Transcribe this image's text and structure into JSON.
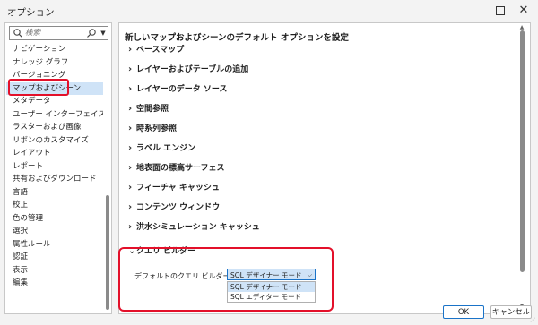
{
  "window": {
    "title": "オプション"
  },
  "search": {
    "placeholder": "検索"
  },
  "sidebar": {
    "items": [
      {
        "label": "ナビゲーション",
        "selected": false
      },
      {
        "label": "ナレッジ グラフ",
        "selected": false
      },
      {
        "label": "バージョニング",
        "selected": false
      },
      {
        "label": "マップおよびシーン",
        "selected": true
      },
      {
        "label": "メタデータ",
        "selected": false
      },
      {
        "label": "ユーザー インターフェイス",
        "selected": false
      },
      {
        "label": "ラスターおよび画像",
        "selected": false
      },
      {
        "label": "リボンのカスタマイズ",
        "selected": false
      },
      {
        "label": "レイアウト",
        "selected": false
      },
      {
        "label": "レポート",
        "selected": false
      },
      {
        "label": "共有およびダウンロード",
        "selected": false
      },
      {
        "label": "言語",
        "selected": false
      },
      {
        "label": "校正",
        "selected": false
      },
      {
        "label": "色の管理",
        "selected": false
      },
      {
        "label": "選択",
        "selected": false
      },
      {
        "label": "属性ルール",
        "selected": false
      },
      {
        "label": "認証",
        "selected": false
      },
      {
        "label": "表示",
        "selected": false
      },
      {
        "label": "編集",
        "selected": false
      }
    ]
  },
  "main": {
    "heading": "新しいマップおよびシーンのデフォルト オプションを設定",
    "sections": [
      {
        "label": "ベースマップ",
        "expanded": false
      },
      {
        "label": "レイヤーおよびテーブルの追加",
        "expanded": false
      },
      {
        "label": "レイヤーのデータ ソース",
        "expanded": false
      },
      {
        "label": "空間参照",
        "expanded": false
      },
      {
        "label": "時系列参照",
        "expanded": false
      },
      {
        "label": "ラベル エンジン",
        "expanded": false
      },
      {
        "label": "地表面の標高サーフェス",
        "expanded": false
      },
      {
        "label": "フィーチャ キャッシュ",
        "expanded": false
      },
      {
        "label": "コンテンツ ウィンドウ",
        "expanded": false
      },
      {
        "label": "洪水シミュレーション キャッシュ",
        "expanded": false
      },
      {
        "label": "クエリ ビルダー",
        "expanded": true
      }
    ],
    "query_builder": {
      "field_label": "デフォルトのクエリ ビルダー モード",
      "selected": "SQL デザイナー モード",
      "options": [
        "SQL デザイナー モード",
        "SQL エディター モード"
      ]
    }
  },
  "buttons": {
    "ok": "OK",
    "cancel": "キャンセル"
  },
  "colors": {
    "highlight_red": "#e3102a",
    "selection_blue": "#cfe3f7",
    "accent_blue": "#1a73c8"
  }
}
